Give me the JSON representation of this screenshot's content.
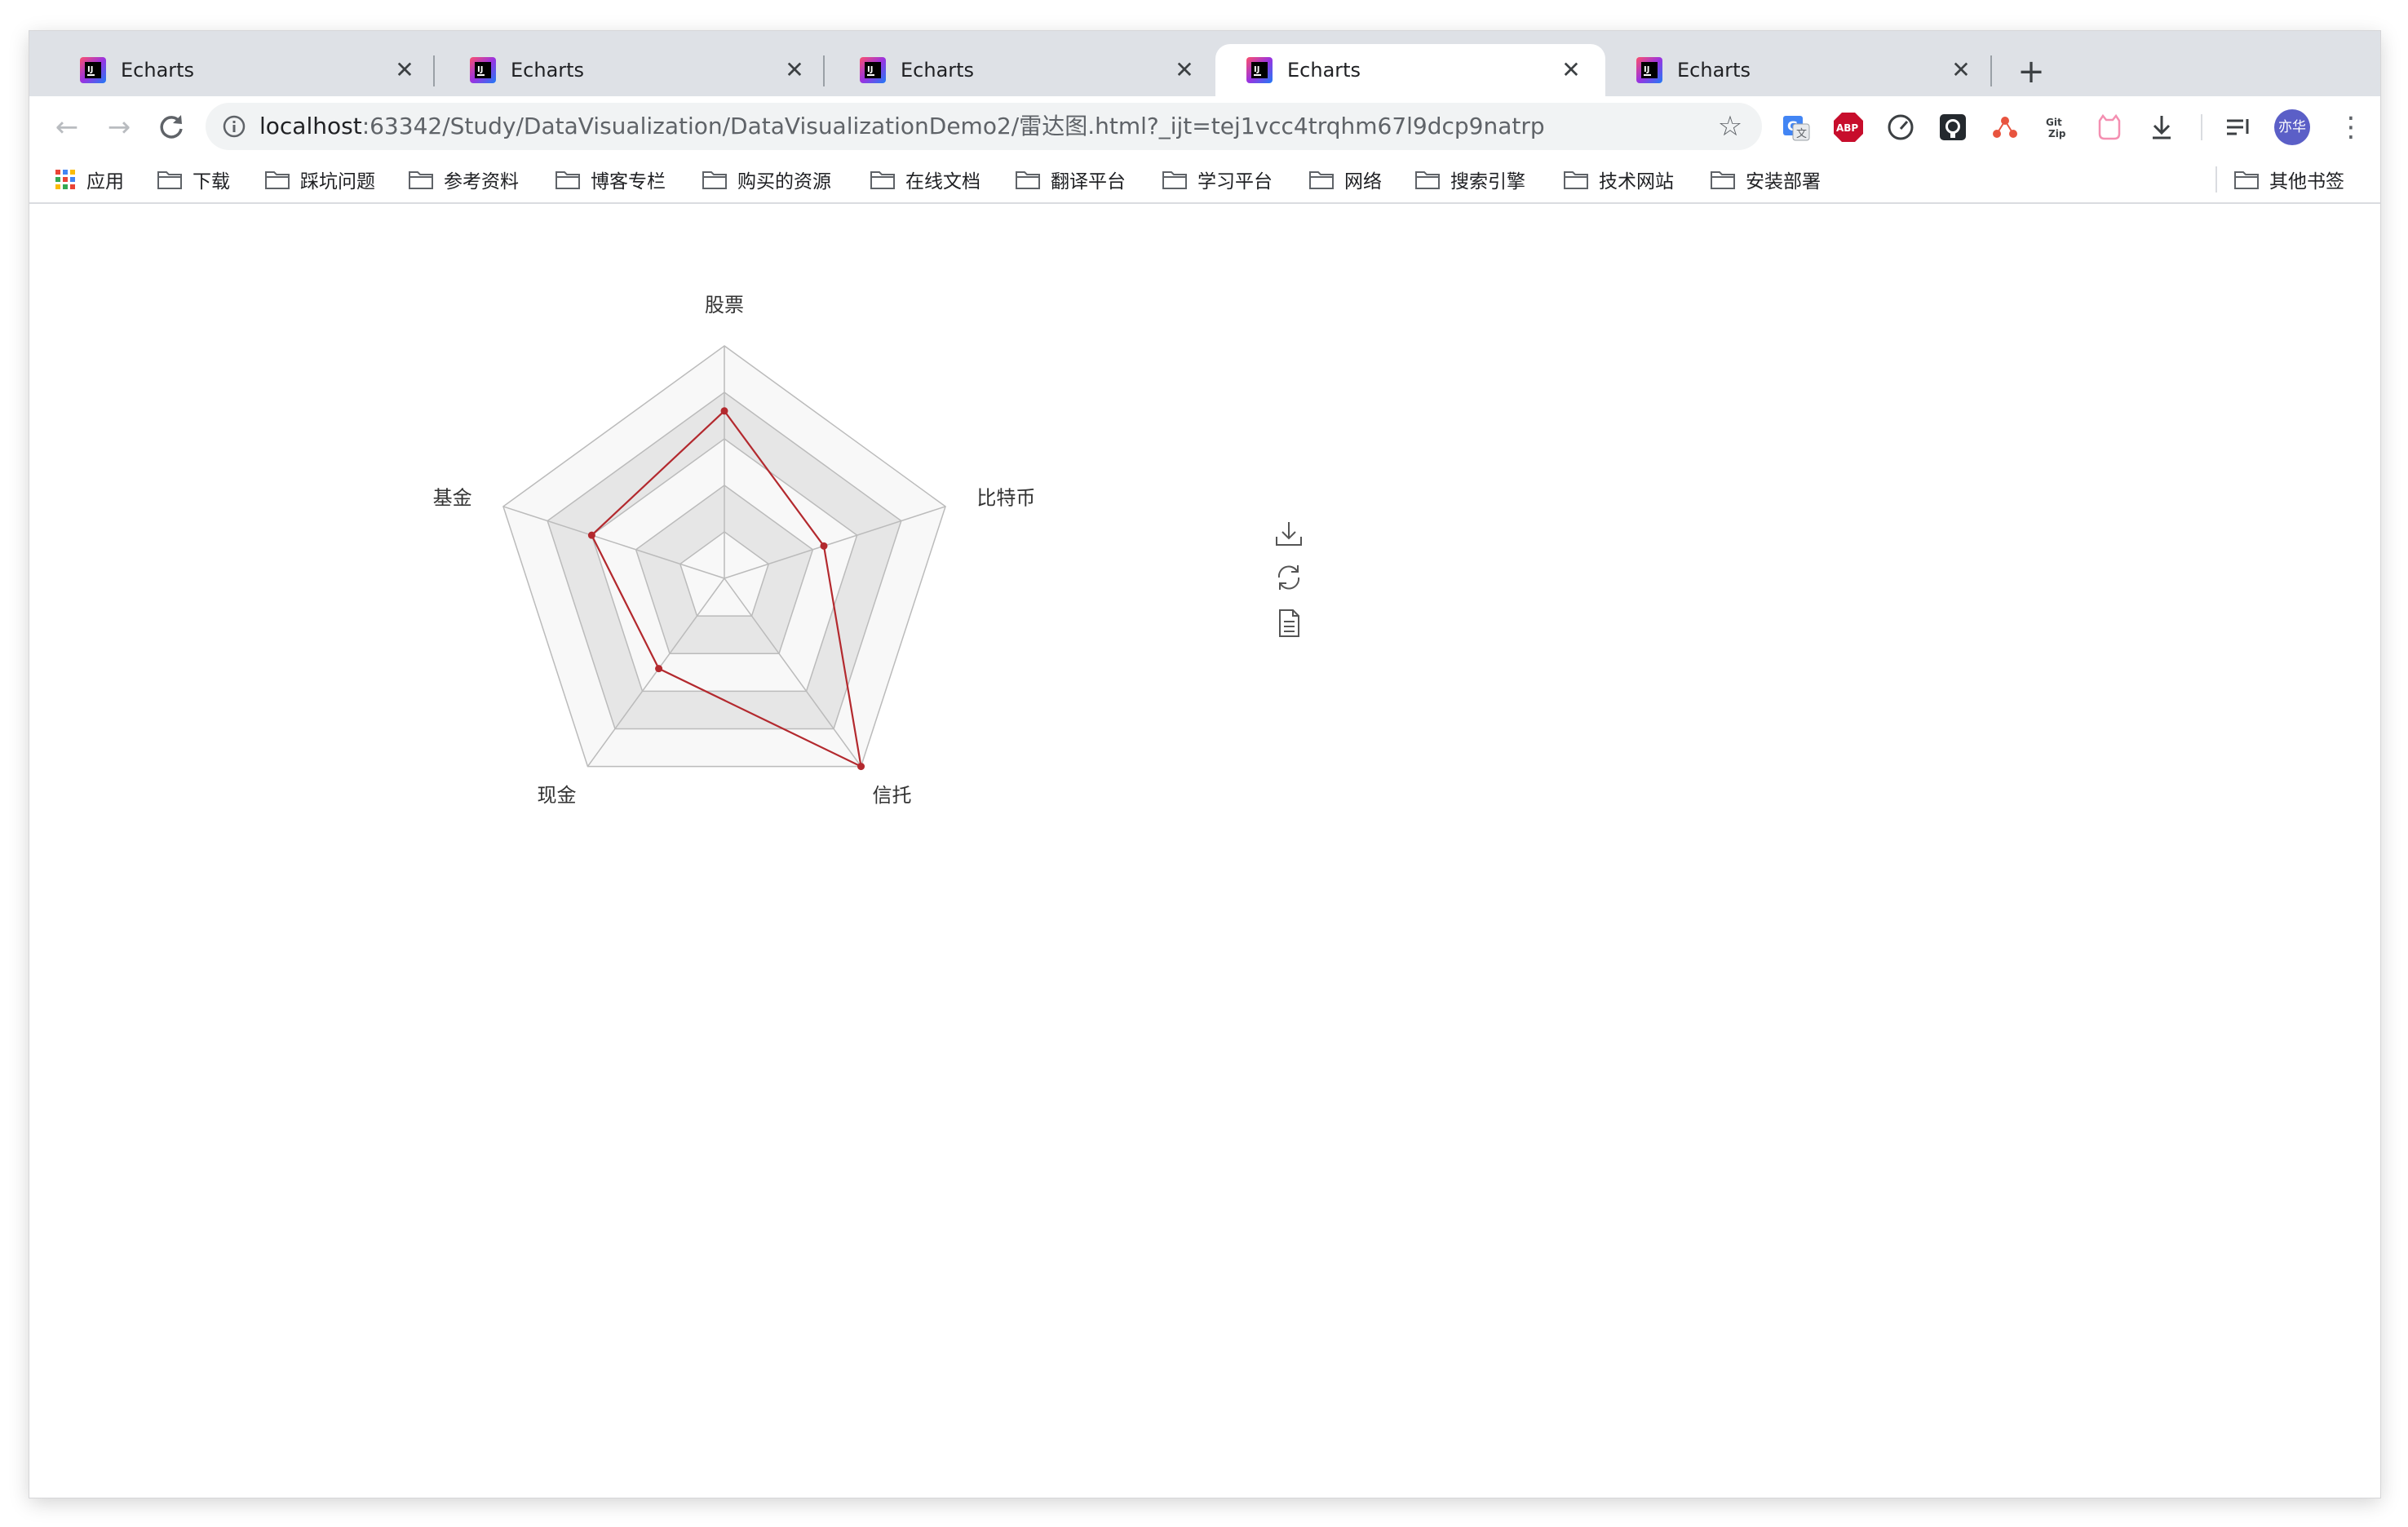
{
  "tabs": [
    {
      "title": "Echarts",
      "active": false
    },
    {
      "title": "Echarts",
      "active": false
    },
    {
      "title": "Echarts",
      "active": false
    },
    {
      "title": "Echarts",
      "active": true
    },
    {
      "title": "Echarts",
      "active": false
    }
  ],
  "toolbar": {
    "url_host": "localhost",
    "url_rest": ":63342/Study/DataVisualization/DataVisualizationDemo2/雷达图.html?_ijt=tej1vcc4trqhm67l9dcp9natrp",
    "avatar_text": "亦华"
  },
  "bookmarks": {
    "apps": "应用",
    "items": [
      "下载",
      "踩坑问题",
      "参考资料",
      "博客专栏",
      "购买的资源",
      "在线文档",
      "翻译平台",
      "学习平台",
      "网络",
      "搜索引擎",
      "技术网站",
      "安装部署"
    ],
    "other": "其他书签"
  },
  "chart_data": {
    "type": "radar",
    "indicators": [
      "股票",
      "比特币",
      "信托",
      "现金",
      "基金"
    ],
    "max": 100,
    "split_number": 5,
    "series": [
      {
        "values": [
          72,
          45,
          100,
          48,
          60
        ]
      }
    ],
    "colors": {
      "line": "#b3292e",
      "split_dark": "#e6e6e6",
      "split_light": "#f8f8f8",
      "axis": "#bbbbbb"
    }
  }
}
